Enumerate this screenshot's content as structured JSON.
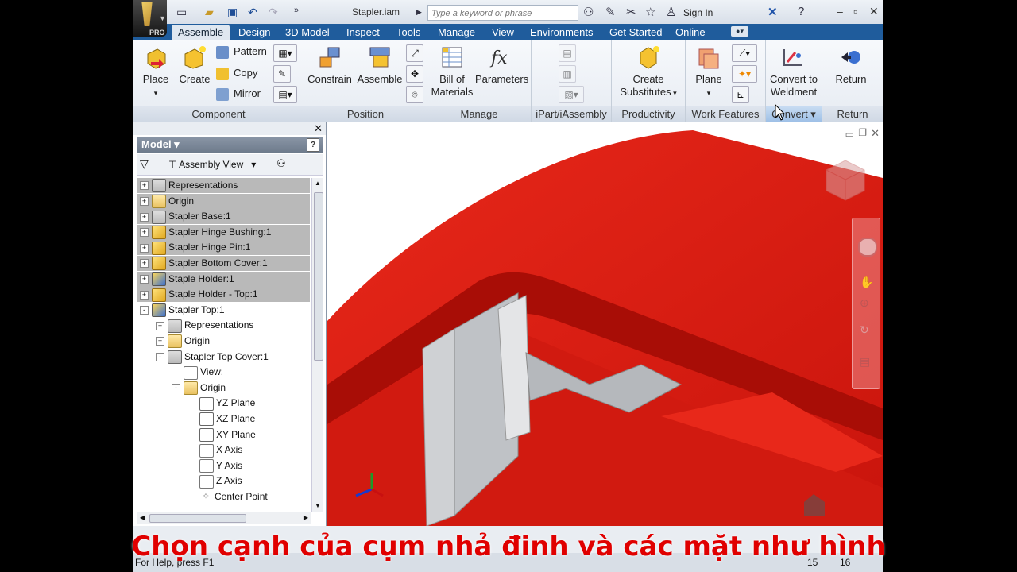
{
  "titlebar": {
    "doc_title": "Stapler.iam",
    "search_placeholder": "Type a keyword or phrase",
    "sign_in": "Sign In",
    "app_badge": "PRO"
  },
  "tabs": [
    "Assemble",
    "Design",
    "3D Model",
    "Inspect",
    "Tools",
    "Manage",
    "View",
    "Environments",
    "Get Started",
    "Online"
  ],
  "ribbon": {
    "component": {
      "label": "Component",
      "place": "Place",
      "create": "Create",
      "pattern": "Pattern",
      "copy": "Copy",
      "mirror": "Mirror"
    },
    "position": {
      "label": "Position",
      "constrain": "Constrain",
      "assemble": "Assemble"
    },
    "manage": {
      "label": "Manage",
      "bom_line1": "Bill of",
      "bom_line2": "Materials",
      "parameters": "Parameters"
    },
    "ipart": {
      "label": "iPart/iAssembly"
    },
    "productivity": {
      "label": "Productivity",
      "create_sub_line1": "Create",
      "create_sub_line2": "Substitutes"
    },
    "work_features": {
      "label": "Work Features",
      "plane": "Plane"
    },
    "convert": {
      "label": "Convert",
      "btn_line1": "Convert to",
      "btn_line2": "Weldment"
    },
    "return": {
      "label": "Return",
      "btn": "Return"
    }
  },
  "browser": {
    "title": "Model",
    "view": "Assembly View",
    "help": "?",
    "tree": [
      {
        "label": "Representations",
        "icon": "rep",
        "exp": "+",
        "indent": 0,
        "sel": true
      },
      {
        "label": "Origin",
        "icon": "folder",
        "exp": "+",
        "indent": 0,
        "sel": true
      },
      {
        "label": "Stapler Base:1",
        "icon": "rep",
        "exp": "+",
        "indent": 0,
        "sel": true
      },
      {
        "label": "Stapler Hinge Bushing:1",
        "icon": "part",
        "exp": "+",
        "indent": 0,
        "sel": true
      },
      {
        "label": "Stapler Hinge Pin:1",
        "icon": "part",
        "exp": "+",
        "indent": 0,
        "sel": true
      },
      {
        "label": "Stapler Bottom Cover:1",
        "icon": "part",
        "exp": "+",
        "indent": 0,
        "sel": true
      },
      {
        "label": "Staple Holder:1",
        "icon": "asm",
        "exp": "+",
        "indent": 0,
        "sel": true
      },
      {
        "label": "Staple Holder - Top:1",
        "icon": "part",
        "exp": "+",
        "indent": 0,
        "sel": true
      },
      {
        "label": "Stapler Top:1",
        "icon": "asm",
        "exp": "-",
        "indent": 0,
        "sel": false
      },
      {
        "label": "Representations",
        "icon": "rep",
        "exp": "+",
        "indent": 1,
        "sel": false
      },
      {
        "label": "Origin",
        "icon": "folder",
        "exp": "+",
        "indent": 1,
        "sel": false
      },
      {
        "label": "Stapler Top Cover:1",
        "icon": "rep",
        "exp": "-",
        "indent": 1,
        "sel": false
      },
      {
        "label": "View:",
        "icon": "axis",
        "exp": "",
        "indent": 2,
        "sel": false
      },
      {
        "label": "Origin",
        "icon": "folder",
        "exp": "-",
        "indent": 2,
        "sel": false
      },
      {
        "label": "YZ Plane",
        "icon": "plane",
        "exp": "",
        "indent": 3,
        "sel": false
      },
      {
        "label": "XZ Plane",
        "icon": "plane",
        "exp": "",
        "indent": 3,
        "sel": false
      },
      {
        "label": "XY Plane",
        "icon": "plane",
        "exp": "",
        "indent": 3,
        "sel": false
      },
      {
        "label": "X Axis",
        "icon": "axis",
        "exp": "",
        "indent": 3,
        "sel": false
      },
      {
        "label": "Y Axis",
        "icon": "axis",
        "exp": "",
        "indent": 3,
        "sel": false
      },
      {
        "label": "Z Axis",
        "icon": "axis",
        "exp": "",
        "indent": 3,
        "sel": false
      },
      {
        "label": "Center Point",
        "icon": "point",
        "exp": "",
        "indent": 3,
        "sel": false
      }
    ]
  },
  "status": {
    "help": "For Help, press F1",
    "n1": "15",
    "n2": "16"
  },
  "caption": "Chọn cạnh của cụm nhả đinh và các mặt như hình",
  "colors": {
    "model_red": "#d81a10",
    "caption_red": "#e00000",
    "tab_blue": "#1f5c9c"
  }
}
